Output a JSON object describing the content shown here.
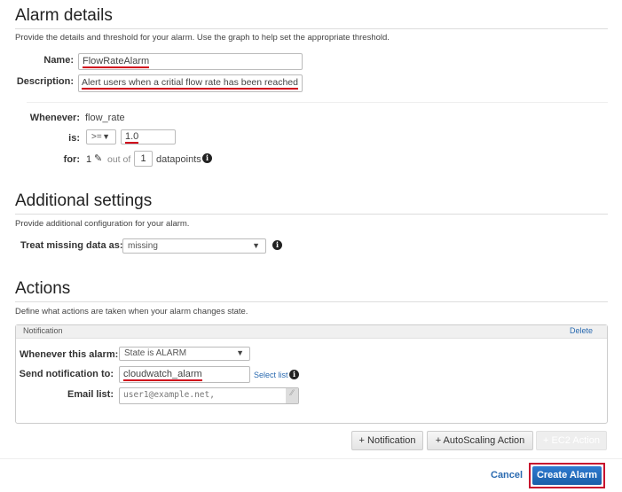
{
  "alarm_details": {
    "title": "Alarm details",
    "subtitle": "Provide the details and threshold for your alarm. Use the graph to help set the appropriate threshold.",
    "name_label": "Name:",
    "name_value": "FlowRateAlarm",
    "description_label": "Description:",
    "description_value": "Alert users when a critial flow rate has been reached",
    "whenever_label": "Whenever:",
    "metric": "flow_rate",
    "is_label": "is:",
    "operator": ">=",
    "threshold": "1.0",
    "for_label": "for:",
    "datapoints_count": "1",
    "out_of": "out of",
    "evaluation_periods": "1",
    "datapoints_label": "datapoints"
  },
  "additional_settings": {
    "title": "Additional settings",
    "subtitle": "Provide additional configuration for your alarm.",
    "missing_label": "Treat missing data as:",
    "missing_value": "missing"
  },
  "actions": {
    "title": "Actions",
    "subtitle": "Define what actions are taken when your alarm changes state.",
    "notification": {
      "header": "Notification",
      "delete": "Delete",
      "whenever_label": "Whenever this alarm:",
      "state_value": "State is ALARM",
      "send_label": "Send notification to:",
      "send_value": "cloudwatch_alarm",
      "select_list": "Select list",
      "email_label": "Email list:",
      "email_value": "user1@example.net,"
    },
    "buttons": {
      "notification": "+ Notification",
      "autoscaling": "+ AutoScaling Action",
      "ec2": "+ EC2 Action"
    }
  },
  "footer": {
    "cancel": "Cancel",
    "create": "Create Alarm"
  }
}
